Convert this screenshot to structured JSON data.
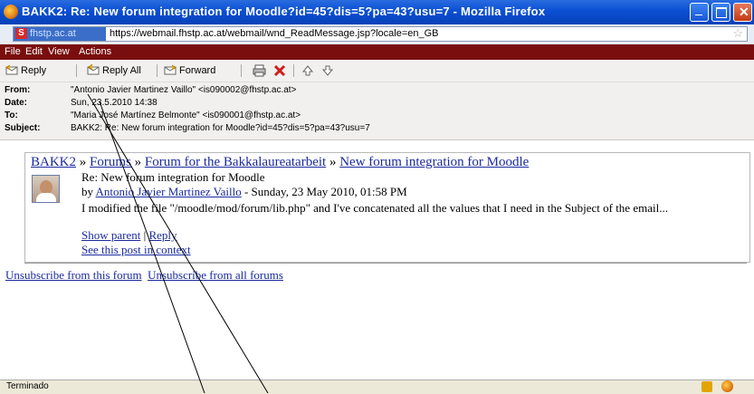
{
  "window": {
    "title": "BAKK2: Re: New forum integration for Moodle?id=45?dis=5?pa=43?usu=7 - Mozilla Firefox"
  },
  "urlbar": {
    "site": "fhstp.ac.at",
    "url": "https://webmail.fhstp.ac.at/webmail/wnd_ReadMessage.jsp?locale=en_GB"
  },
  "menu": [
    "File",
    "Edit",
    "View",
    "Actions"
  ],
  "toolbar": {
    "reply": "Reply",
    "reply_all": "Reply All",
    "forward": "Forward"
  },
  "headers": {
    "from_label": "From:",
    "from": "\"Antonio Javier Martinez Vaillo\" <is090002@fhstp.ac.at>",
    "date_label": "Date:",
    "date": "Sun, 23.5.2010 14:38",
    "to_label": "To:",
    "to": "\"Maria José Martínez Belmonte\" <is090001@fhstp.ac.at>",
    "subject_label": "Subject:",
    "subject": "BAKK2: Re: New forum integration for Moodle?id=45?dis=5?pa=43?usu=7"
  },
  "post": {
    "crumbs": [
      "BAKK2",
      "Forums",
      "Forum for the Bakkalaureatarbeit",
      "New forum integration for Moodle"
    ],
    "crumb_sep": " » ",
    "subject": "Re: New forum integration for Moodle",
    "by_prefix": "by ",
    "author": "Antonio Javier Martinez Vaillo",
    "date": " - Sunday, 23 May 2010, 01:58 PM",
    "message": "I modified the file \"/moodle/mod/forum/lib.php\" and I've concatenated all the values that I need in the Subject of the email...",
    "show_parent": "Show parent",
    "link_sep": " | ",
    "reply": "Reply",
    "see_context": "See this post in context"
  },
  "unsubscribe": {
    "this_forum": "Unsubscribe from this forum",
    "all_forums": "Unsubscribe from all forums"
  },
  "status": {
    "text": "Terminado"
  },
  "colors": {
    "titlebar": "#0a4fd3",
    "menubar": "#7a0e0e",
    "link": "#1a2a9e"
  }
}
